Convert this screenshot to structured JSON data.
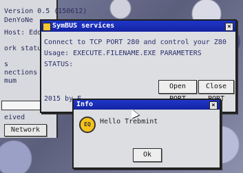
{
  "background_window": {
    "version": "Version 0.5 (150612)",
    "author_fragment": "DenYoNe",
    "host_label": "Host: Edo",
    "network_status_fragment": "ork status",
    "connections_fragment_1": "s",
    "connections_fragment_2": "nections",
    "connections_fragment_3": "mum",
    "received_fragment": "eived",
    "network_button": "Network",
    "footer_fragment": "2015 by E"
  },
  "symbus_window": {
    "title": "SymBUS services",
    "line1": "Connect to TCP PORT 280 and control your Z80",
    "line2": "Usage: EXECUTE.FILENAME.EXE PARAMETERS",
    "status_label": "STATUS:",
    "open_port": "Open PORT",
    "close_port": "Close PORT"
  },
  "info_dialog": {
    "title": "Info",
    "message": "Hello Trebmint",
    "badge_text": "EQ",
    "ok": "Ok"
  },
  "icons": {
    "window_icon": "symbus-window-icon",
    "close": "close-icon",
    "info": "info-badge-icon",
    "cursor": "mouse-cursor-icon"
  },
  "colors": {
    "titlebar": "#1e36c9",
    "window_bg": "#dcdee2",
    "badge": "#f6c21b"
  }
}
